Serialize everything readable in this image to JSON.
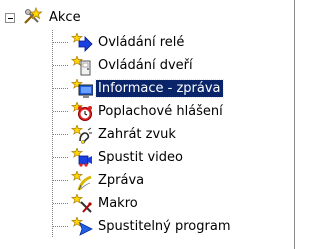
{
  "tree": {
    "root": {
      "label": "Akce",
      "icon": "star-tools-icon",
      "expanded": true
    },
    "selected_index": 2,
    "selection_color": "#0a246a",
    "items": [
      {
        "label": "Ovládání relé",
        "icon": "relay-arrow-icon"
      },
      {
        "label": "Ovládání dveří",
        "icon": "door-icon"
      },
      {
        "label": "Informace - zpráva",
        "icon": "info-monitor-icon"
      },
      {
        "label": "Poplachové hlášení",
        "icon": "alarm-clock-icon"
      },
      {
        "label": "Zahrát zvuk",
        "icon": "sound-icon"
      },
      {
        "label": "Spustit video",
        "icon": "video-icon"
      },
      {
        "label": "Zpráva",
        "icon": "message-pen-icon"
      },
      {
        "label": "Makro",
        "icon": "macro-tools-icon"
      },
      {
        "label": "Spustitelný program",
        "icon": "program-arrow-icon"
      }
    ]
  }
}
